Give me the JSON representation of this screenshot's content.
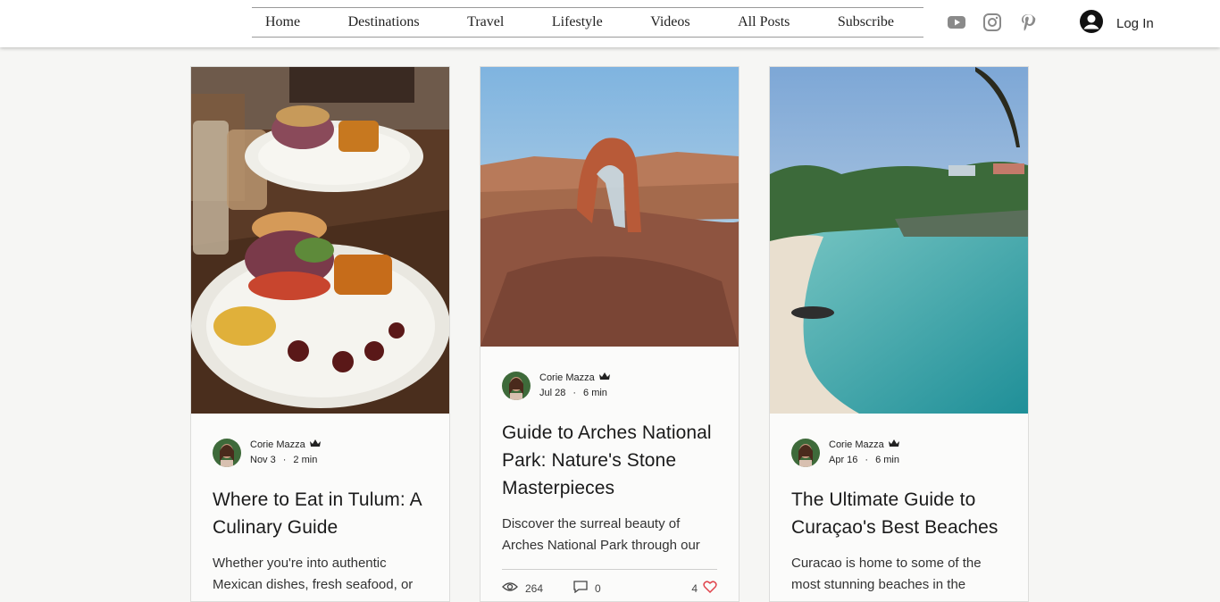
{
  "nav": {
    "items": [
      "Home",
      "Destinations",
      "Travel",
      "Lifestyle",
      "Videos",
      "All Posts",
      "Subscribe"
    ]
  },
  "social": [
    "youtube-icon",
    "instagram-icon",
    "pinterest-icon"
  ],
  "login": {
    "label": "Log In"
  },
  "colors": {
    "nav_border": "#9a9a9a",
    "social_icon": "#8a8a8a",
    "like_heart": "#e0454d"
  },
  "posts": [
    {
      "author": "Corie Mazza",
      "date": "Nov 3",
      "read_time": "2 min",
      "title": "Where to Eat in Tulum: A Culinary Guide",
      "excerpt": "Whether you're into authentic Mexican dishes, fresh seafood, or"
    },
    {
      "author": "Corie Mazza",
      "date": "Jul 28",
      "read_time": "6 min",
      "title": "Guide to Arches National Park: Nature's Stone Masterpieces",
      "excerpt": "Discover the surreal beauty of Arches National Park through our",
      "views": "264",
      "comments": "0",
      "likes": "4"
    },
    {
      "author": "Corie Mazza",
      "date": "Apr 16",
      "read_time": "6 min",
      "title": "The Ultimate Guide to Curaçao's Best Beaches",
      "excerpt": "Curacao is home to some of the most stunning beaches in the"
    }
  ]
}
